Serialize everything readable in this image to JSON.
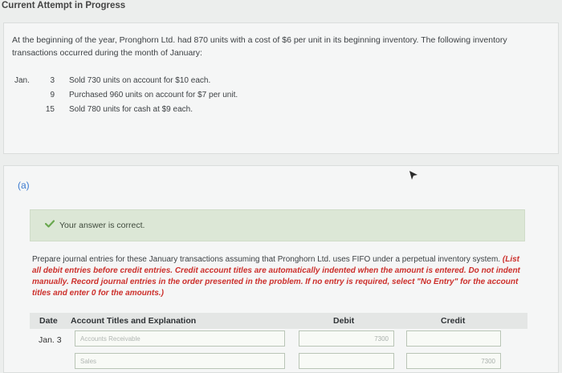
{
  "page": {
    "title": "Current Attempt in Progress"
  },
  "problem": {
    "text": "At the beginning of the year, Pronghorn Ltd. had 870 units with a cost of $6 per unit in its beginning inventory. The following inventory transactions occurred during the month of January:",
    "month": "Jan.",
    "transactions": [
      {
        "day": "3",
        "description": "Sold 730 units on account for $10 each."
      },
      {
        "day": "9",
        "description": "Purchased 960 units on account for $7 per unit."
      },
      {
        "day": "15",
        "description": "Sold 780 units for cash at $9 each."
      }
    ]
  },
  "part": {
    "label": "(a)",
    "status_text": "Your answer is correct.",
    "instructions_black": "Prepare journal entries for these January transactions assuming that Pronghorn Ltd. uses FIFO under a perpetual inventory system.",
    "instructions_red": "(List all debit entries before credit entries. Credit account titles are automatically indented when the amount is entered. Do not indent manually. Record journal entries in the order presented in the problem. If no entry is required, select \"No Entry\" for the account titles and enter 0 for the amounts.)"
  },
  "journal": {
    "headers": {
      "date": "Date",
      "account": "Account Titles and Explanation",
      "debit": "Debit",
      "credit": "Credit"
    },
    "rows": [
      {
        "date": "Jan. 3",
        "account": "Accounts Receivable",
        "debit": "7300",
        "credit": ""
      },
      {
        "date": "",
        "account": "Sales",
        "debit": "",
        "credit": "7300"
      }
    ]
  },
  "colors": {
    "accent_blue": "#3b7ad0",
    "success_green": "#6aa84f",
    "instruction_red": "#cc2f2b"
  },
  "icons": [
    "check-icon",
    "cursor-icon"
  ]
}
